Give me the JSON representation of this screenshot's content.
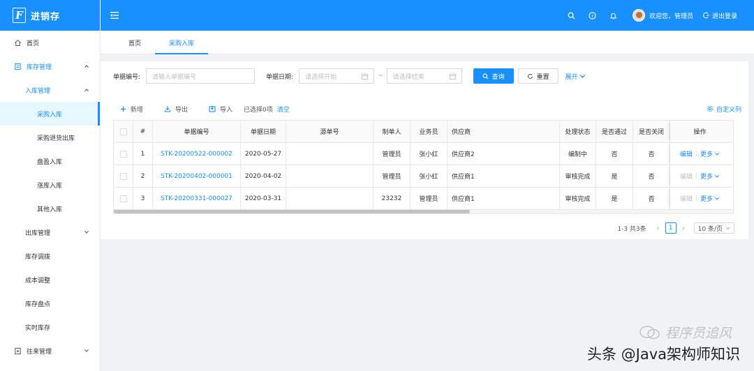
{
  "app": {
    "logo_letter": "F",
    "title": "进销存"
  },
  "header": {
    "welcome": "欢迎您，管理员",
    "logout": "退出登录"
  },
  "sidebar": {
    "home": "首页",
    "inventory": "库存管理",
    "inbound": "入库管理",
    "inbound_items": [
      "采购入库",
      "采购退货出库",
      "盘盈入库",
      "涨库入库",
      "其他入库"
    ],
    "outbound": "出库管理",
    "others": [
      "库存调拨",
      "成本调整",
      "库存盘点",
      "实时库存"
    ],
    "contacts": "往来管理"
  },
  "tabs": [
    "首页",
    "采购入库"
  ],
  "search": {
    "doc_no_label": "单据编号:",
    "doc_no_placeholder": "请输入单据编号",
    "date_label": "单据日期:",
    "date_start_placeholder": "请选择开始",
    "date_sep": "~",
    "date_end_placeholder": "请选择结束",
    "query": "查询",
    "reset": "重置",
    "expand": "展开"
  },
  "toolbar": {
    "add": "新增",
    "export": "导出",
    "import": "导入",
    "selected": "已选择0项",
    "clear": "清空",
    "custom_columns": "自定义列"
  },
  "table": {
    "columns": [
      "#",
      "单据编号",
      "单据日期",
      "源单号",
      "制单人",
      "业务员",
      "供应商",
      "处理状态",
      "是否通过",
      "是否关闭",
      "操作"
    ],
    "rows": [
      {
        "idx": "1",
        "doc_no": "STK-20200522-000002",
        "date": "2020-05-27",
        "src": "",
        "creator": "管理员",
        "salesman": "张小红",
        "supplier": "供应商2",
        "status": "编制中",
        "passed": "否",
        "closed": "否",
        "edit": "编辑",
        "more": "更多",
        "edit_enabled": true
      },
      {
        "idx": "2",
        "doc_no": "STK-20200402-000001",
        "date": "2020-04-02",
        "src": "",
        "creator": "管理员",
        "salesman": "张小红",
        "supplier": "供应商1",
        "status": "审核完成",
        "passed": "是",
        "closed": "否",
        "edit": "编辑",
        "more": "更多",
        "edit_enabled": false
      },
      {
        "idx": "3",
        "doc_no": "STK-20200331-000027",
        "date": "2020-03-31",
        "src": "",
        "creator": "23232",
        "salesman": "管理员",
        "supplier": "供应商1",
        "status": "审核完成",
        "passed": "是",
        "closed": "否",
        "edit": "编辑",
        "more": "更多",
        "edit_enabled": false
      }
    ]
  },
  "pagination": {
    "total": "1-3 共3条",
    "current": "1",
    "page_size": "10 条/页"
  },
  "watermark": {
    "top": "程序员追风",
    "bottom": "头条 @Java架构师知识"
  },
  "colors": {
    "primary": "#1890ff",
    "header_bg": "#1890ff",
    "page_bg": "#f0f2f5"
  }
}
